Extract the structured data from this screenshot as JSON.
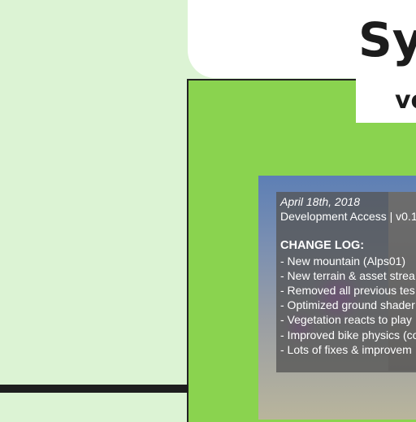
{
  "header": {
    "title": "Sy",
    "version": "ve"
  },
  "changelog": {
    "date": "April 18th, 2018",
    "build": "Development Access | v0.1",
    "heading": "CHANGE LOG:",
    "items": [
      "- New mountain (Alps01)",
      "- New terrain & asset strea",
      "- Removed all previous tes",
      "- Optimized ground shader",
      "- Vegetation reacts to play",
      "- Improved bike physics (co",
      "- Lots of fixes & improvem"
    ]
  },
  "colors": {
    "background": "#dcf3d4",
    "panel_green": "#8ad34f",
    "card_white": "#ffffff",
    "text_dark": "#1c1c1c"
  }
}
